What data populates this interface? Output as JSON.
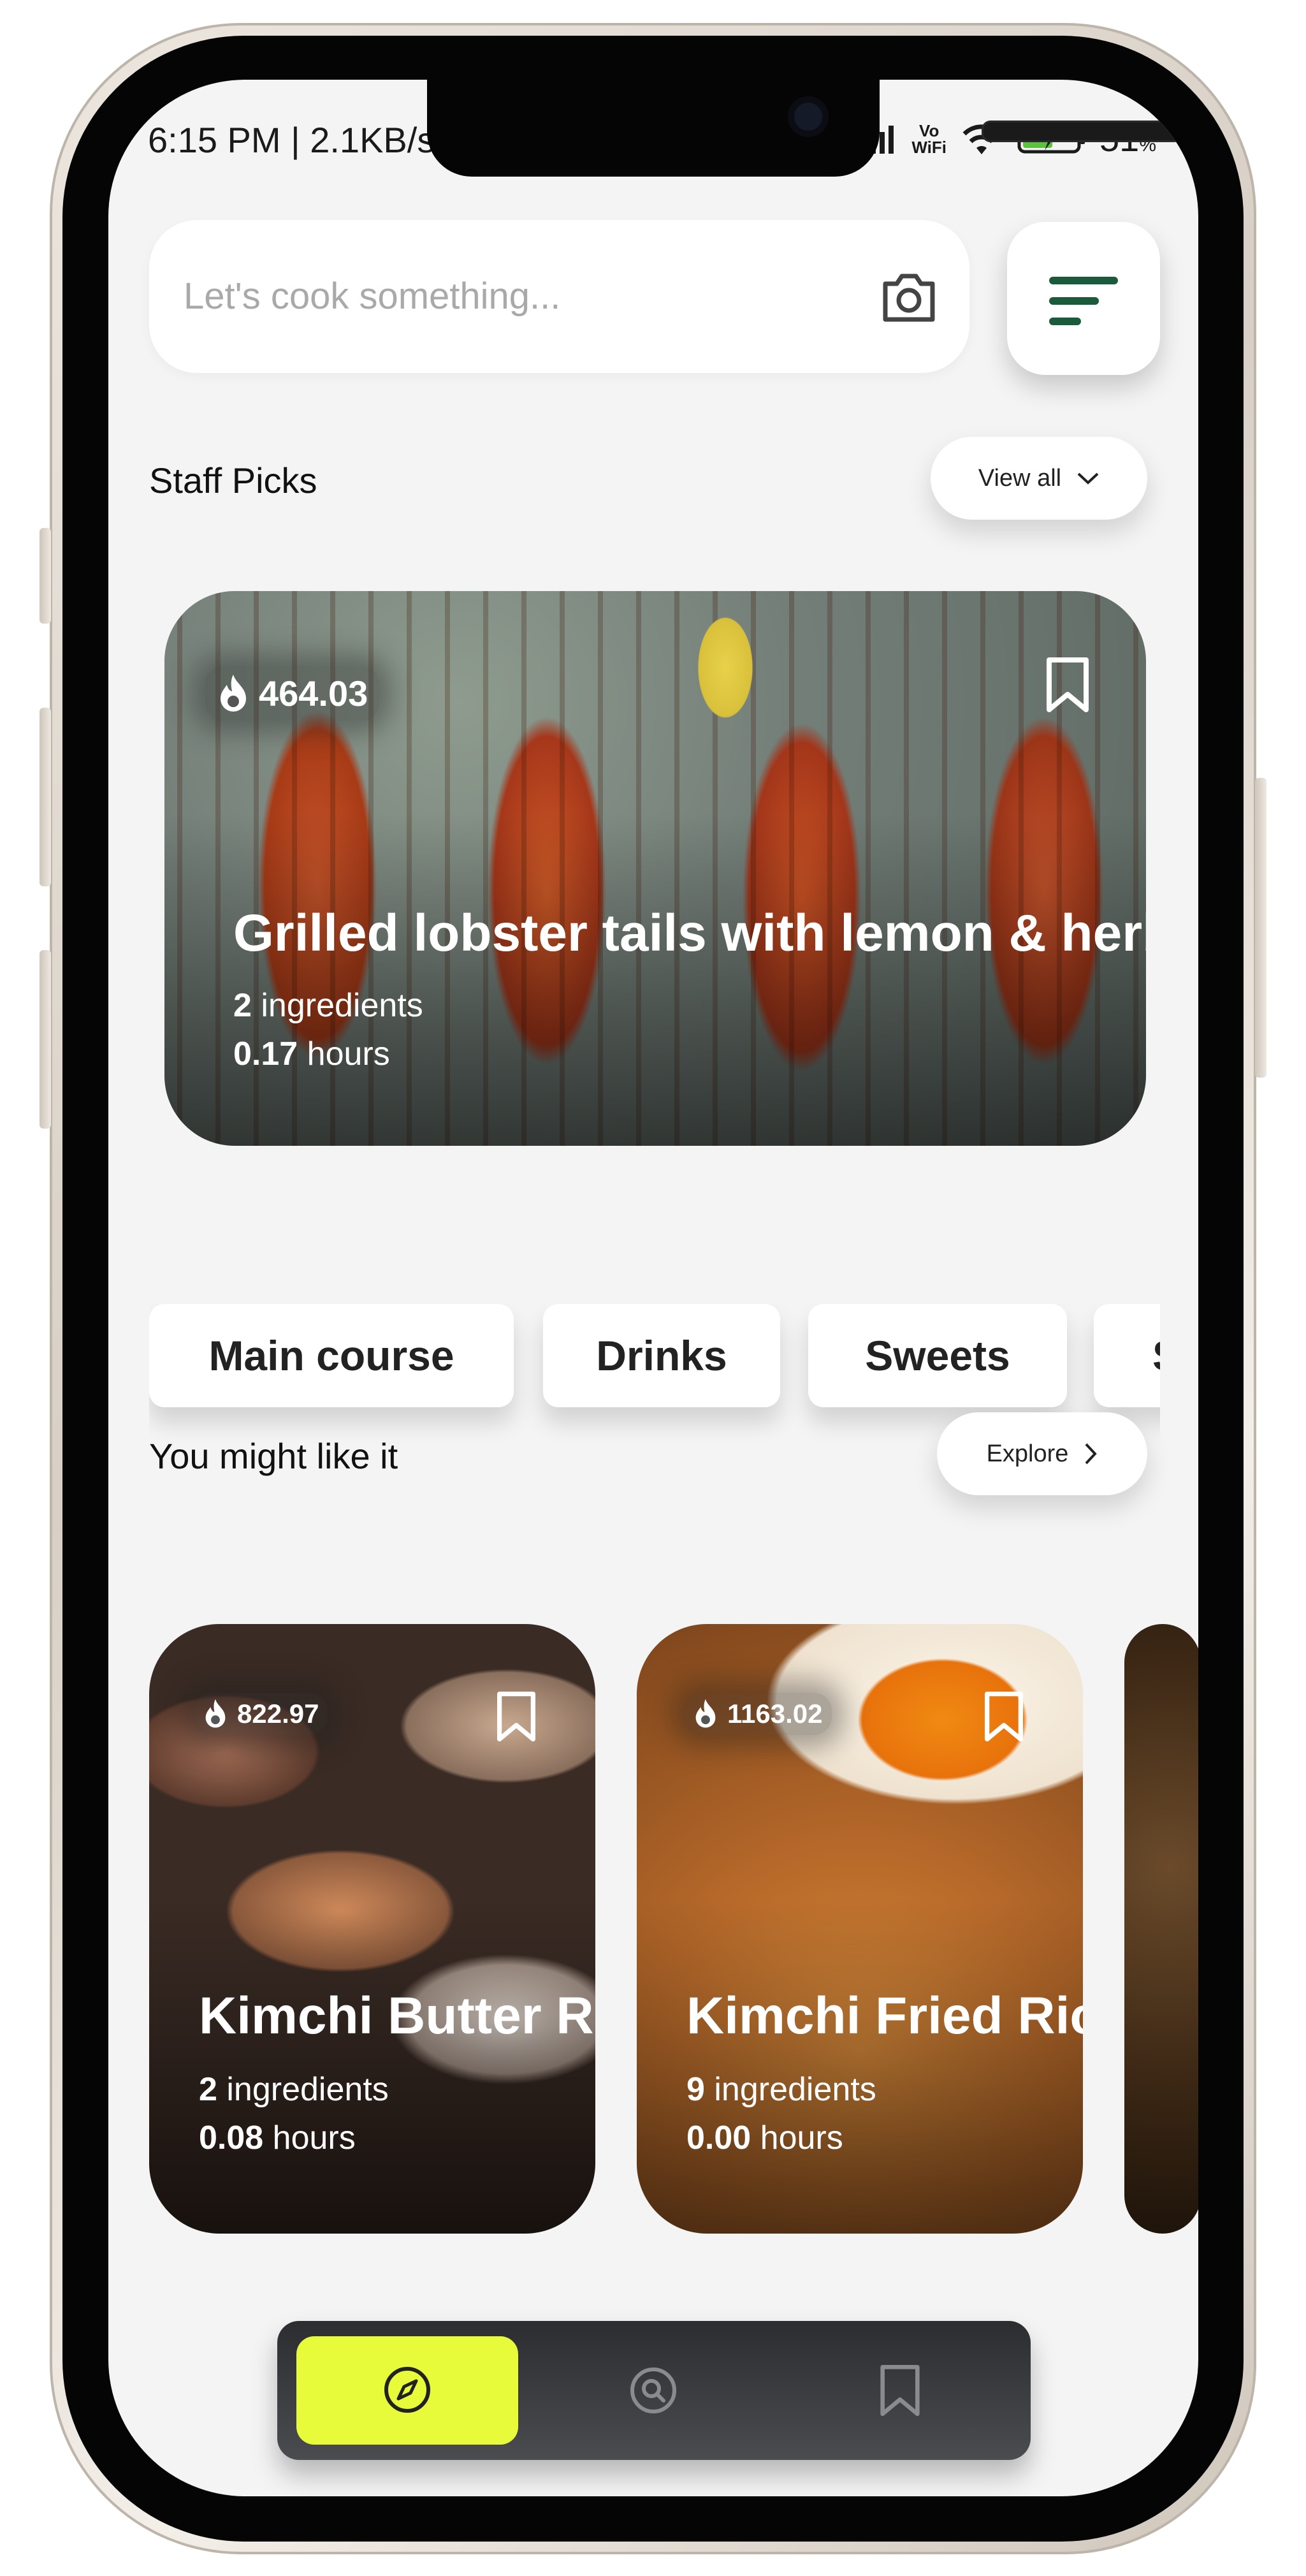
{
  "status_bar": {
    "time": "6:15 PM | 2.1KB/s",
    "volte_line1": "Vo",
    "volte_line2": "WiFi",
    "battery_percent": "51",
    "battery_percent_unit": "%"
  },
  "search": {
    "placeholder": "Let's cook something...",
    "camera_icon": "camera-icon"
  },
  "filter_button": {
    "icon": "filter-icon"
  },
  "staff_picks": {
    "title": "Staff Picks",
    "view_all_label": "View all",
    "recipe": {
      "calories": "464.03",
      "title": "Grilled lobster tails with lemon & herbs",
      "ingredients_count": "2",
      "ingredients_label": "ingredients",
      "hours_value": "0.17",
      "hours_label": "hours"
    }
  },
  "categories": [
    "Main course",
    "Drinks",
    "Sweets",
    "S"
  ],
  "you_might_like": {
    "title": "You might like it",
    "explore_label": "Explore",
    "cards": [
      {
        "calories": "822.97",
        "title": "Kimchi Butter Re",
        "ingredients_count": "2",
        "ingredients_label": "ingredients",
        "hours_value": "0.08",
        "hours_label": "hours"
      },
      {
        "calories": "1163.02",
        "title": "Kimchi Fried Ric",
        "ingredients_count": "9",
        "ingredients_label": "ingredients",
        "hours_value": "0.00",
        "hours_label": "hours"
      }
    ]
  },
  "bottom_nav": {
    "items": [
      "compass-icon",
      "search-icon",
      "bookmark-icon"
    ],
    "active_color": "#e8fb3a"
  }
}
